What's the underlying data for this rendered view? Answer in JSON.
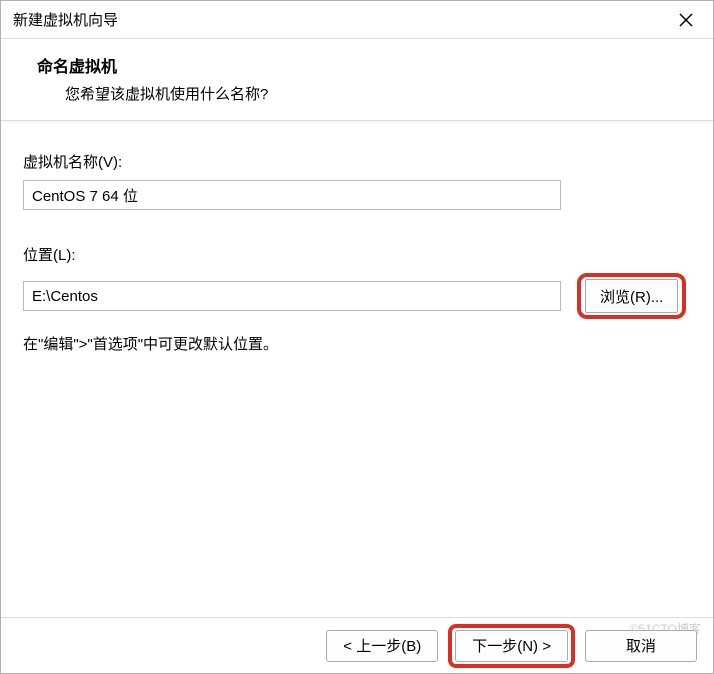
{
  "window": {
    "title": "新建虚拟机向导"
  },
  "header": {
    "title": "命名虚拟机",
    "subtitle": "您希望该虚拟机使用什么名称?"
  },
  "form": {
    "name_label": "虚拟机名称(V):",
    "name_value": "CentOS 7 64 位",
    "location_label": "位置(L):",
    "location_value": "E:\\Centos",
    "browse_label": "浏览(R)...",
    "hint": "在\"编辑\">\"首选项\"中可更改默认位置。"
  },
  "buttons": {
    "back": "< 上一步(B)",
    "next": "下一步(N) >",
    "cancel": "取消"
  },
  "watermark": "©51CTO博客"
}
